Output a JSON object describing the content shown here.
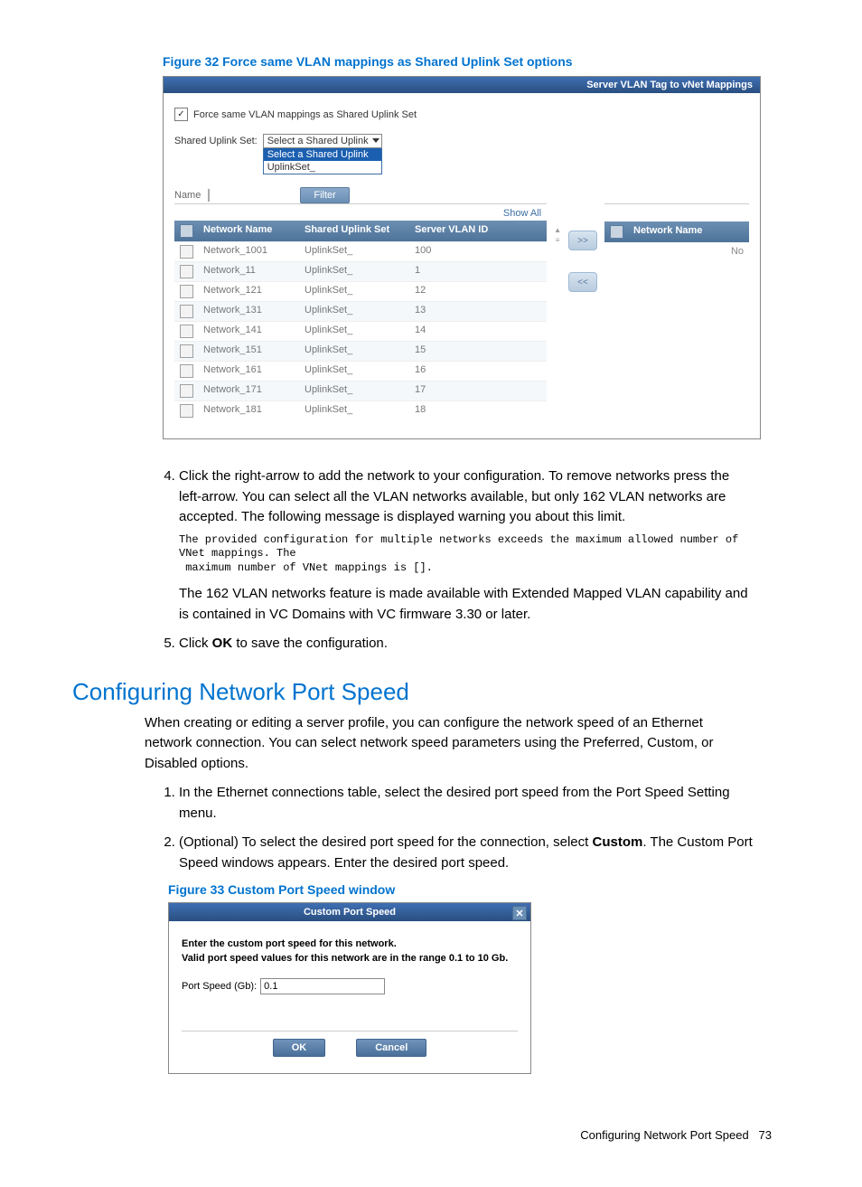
{
  "figure32": {
    "caption": "Figure 32 Force same VLAN mappings as Shared Uplink Set options",
    "panel_title": "Server VLAN Tag to vNet Mappings",
    "force_label": "Force same VLAN mappings as Shared Uplink Set",
    "sus_label": "Shared Uplink Set:",
    "sus_selected": "Select a Shared Uplink",
    "sus_options": {
      "opt1": "Select a Shared Uplink",
      "opt2": "UplinkSet_"
    },
    "name_label": "Name",
    "filter_label": "Filter",
    "show_all": "Show All",
    "headers": {
      "net_name": "Network Name",
      "sus": "Shared Uplink Set",
      "svid": "Server VLAN ID"
    },
    "rows": [
      {
        "name": "Network_1001",
        "sus": "UplinkSet_",
        "vlan": "100"
      },
      {
        "name": "Network_11",
        "sus": "UplinkSet_",
        "vlan": "1"
      },
      {
        "name": "Network_121",
        "sus": "UplinkSet_",
        "vlan": "12"
      },
      {
        "name": "Network_131",
        "sus": "UplinkSet_",
        "vlan": "13"
      },
      {
        "name": "Network_141",
        "sus": "UplinkSet_",
        "vlan": "14"
      },
      {
        "name": "Network_151",
        "sus": "UplinkSet_",
        "vlan": "15"
      },
      {
        "name": "Network_161",
        "sus": "UplinkSet_",
        "vlan": "16"
      },
      {
        "name": "Network_171",
        "sus": "UplinkSet_",
        "vlan": "17"
      },
      {
        "name": "Network_181",
        "sus": "UplinkSet_",
        "vlan": "18"
      }
    ],
    "right_header": "Network Name",
    "right_no": "No",
    "arrow_right": ">>",
    "arrow_left": "<<"
  },
  "steps_top": {
    "item4_a": "Click the right-arrow to add the network to your configuration. To remove networks press the left-arrow. You can select all the VLAN networks available, but only 162 VLAN networks are accepted. The following message is displayed warning you about this limit.",
    "item4_msg": "The provided configuration for multiple networks exceeds the maximum allowed number of VNet mappings. The\n maximum number of VNet mappings is [].",
    "item4_b": "The 162 VLAN networks feature is made available with Extended Mapped VLAN capability and is contained in VC Domains with VC firmware 3.30 or later.",
    "item5_pre": "Click ",
    "item5_bold": "OK",
    "item5_post": " to save the configuration."
  },
  "section_title": "Configuring Network Port Speed",
  "section_para": "When creating or editing a server profile, you can configure the network speed of an Ethernet network connection. You can select network speed parameters using the Preferred, Custom, or Disabled options.",
  "steps2": {
    "item1": "In the Ethernet connections table, select the desired port speed from the Port Speed Setting menu.",
    "item2_pre": "(Optional) To select the desired port speed for the connection, select ",
    "item2_bold": "Custom",
    "item2_post": ". The Custom Port Speed windows appears. Enter the desired port speed."
  },
  "figure33": {
    "caption": "Figure 33 Custom Port Speed window",
    "title": "Custom Port Speed",
    "close": "✕",
    "bold_text": "Enter the custom port speed for this network.\nValid port speed values for this network are in the range 0.1 to 10 Gb.",
    "ps_label": "Port Speed (Gb):",
    "ps_value": "0.1",
    "ok": "OK",
    "cancel": "Cancel"
  },
  "footer": {
    "text": "Configuring Network Port Speed",
    "page": "73"
  }
}
